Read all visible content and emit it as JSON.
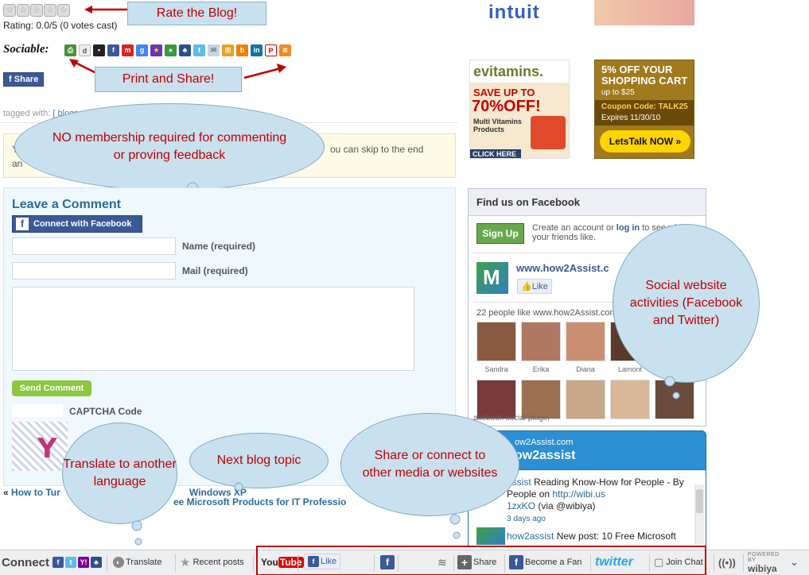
{
  "rating": {
    "text": "Rating: 0.0/5 (0 votes cast)",
    "stars": 5
  },
  "callouts": {
    "rate": "Rate the Blog!",
    "print_share": "Print and Share!",
    "membership": "NO membership required for commenting or proving feedback",
    "social": "Social website activities (Facebook and Twitter)",
    "translate": "Translate to another language",
    "next_topic": "Next blog topic",
    "share_connect": "Share or connect to other media or websites"
  },
  "sociable": {
    "label": "Sociable:",
    "icons": [
      "print-icon",
      "digg-icon",
      "delicious-icon",
      "facebook-icon",
      "mixx-icon",
      "google-icon",
      "favorites-icon",
      "chat-icon",
      "myspace-icon",
      "twitter-icon",
      "email-icon",
      "windows-icon",
      "blogger-icon",
      "linkedin-icon",
      "pdf-icon",
      "rss-icon"
    ],
    "share_button": "Share"
  },
  "tagged": {
    "prefix": "tagged with:",
    "links": "[ blogs, ref"
  },
  "notice": {
    "left": "Yo",
    "left2": "an",
    "right": "ou can skip to the end"
  },
  "comment": {
    "title": "Leave a Comment",
    "connect_fb": "Connect with Facebook",
    "name_label": "Name (required)",
    "mail_label": "Mail (required)",
    "send": "Send Comment",
    "captcha": "CAPTCHA Code"
  },
  "prevnext": {
    "arrow": "«",
    "prev": "How to Tur",
    "prev2": "Windows XP",
    "next": "ee Microsoft Products for IT Professio"
  },
  "ads": {
    "intuit": "intuit",
    "evitamins_brand": "evitamins.",
    "evitamins_save": "SAVE UP TO",
    "evitamins_pct": "70%OFF!",
    "evitamins_sub": "Multi Vitamins Products",
    "evitamins_click": "CLICK HERE",
    "letstalk_title": "5% OFF YOUR SHOPPING CART",
    "letstalk_sub": "up to $25",
    "letstalk_code": "Coupon Code: TALK25",
    "letstalk_exp": "Expires 11/30/10",
    "letstalk_brand": "LetsTalk NOW »"
  },
  "facebook": {
    "header": "Find us on Facebook",
    "signup": "Sign Up",
    "create_prefix": "Create an account or ",
    "login": "log in",
    "create_suffix": " to see what your friends like.",
    "page_name": "www.how2Assist.c",
    "like": "Like",
    "people_count": "22 people like www.how2Assist.com",
    "people": [
      "Sandra",
      "Erika",
      "Diana",
      "Lamont"
    ],
    "plugin": "acebook social plugin"
  },
  "twitter": {
    "site": "ow2Assist.com",
    "handle": "ow2assist",
    "tweet1_user": "assist",
    "tweet1_text": "Reading Know-How for People - By People on",
    "tweet1_link": "http://wibi.us",
    "tweet1_rest": "1zxKO",
    "tweet1_via": "(via @wibiya)",
    "tweet1_time": "3 days ago",
    "tweet2_user": "how2assist",
    "tweet2_text": "New post: 10 Free Microsoft"
  },
  "toolbar": {
    "connect": "Connect",
    "translate": "Translate",
    "recent": "Recent posts",
    "youtube": "YouTube",
    "like": "Like",
    "share": "Share",
    "become_fan": "Become a Fan",
    "twitter": "twitter",
    "join_chat": "Join Chat",
    "powered_by": "POWERED BY",
    "wibiya": "wibiya"
  },
  "colors": {
    "callout_text": "#c00000",
    "callout_bg": "#c9e1ef",
    "facebook": "#3b5998",
    "twitter": "#2b8fd4",
    "send_green": "#8dc63f"
  }
}
